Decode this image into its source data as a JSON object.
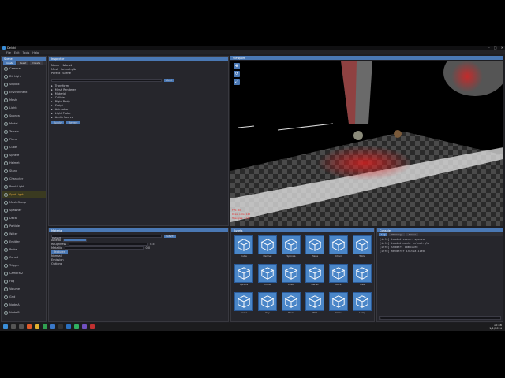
{
  "window": {
    "title": "Deluki",
    "controls": [
      "–",
      "□",
      "✕"
    ]
  },
  "menu": [
    "File",
    "Edit",
    "Tools",
    "Help"
  ],
  "hierarchy": {
    "header": "Scene",
    "tabs": [
      "Create",
      "Reset",
      "Delete"
    ],
    "items": [
      "Camera",
      "Dir Light",
      "Skybox",
      "Environment",
      "Mesh",
      "Light",
      "Sponza",
      "Model",
      "Terrain",
      "Plane",
      "Cube",
      "Sphere",
      "Helmet",
      "Stand",
      "Character",
      "Point Light",
      "Spot Light",
      "Mesh Group",
      "Spawner",
      "Decal",
      "Particle",
      "Water",
      "Emitter",
      "Probe",
      "Sound",
      "Trigger",
      "Camera 2",
      "Fog",
      "Volume",
      "Grid",
      "Node A",
      "Node B"
    ],
    "selected_index": 16
  },
  "inspector": {
    "header": "Inspector",
    "fields": [
      {
        "label": "Name",
        "value": "Helmet"
      },
      {
        "label": "Mesh",
        "value": "helmet.glb"
      },
      {
        "label": "Parent",
        "value": "Scene"
      }
    ],
    "button": "Add",
    "components": [
      "Transform",
      "Mesh Renderer",
      "Material",
      "Collider",
      "Rigid Body",
      "Script",
      "Animation",
      "Light Probe",
      "Audio Source"
    ],
    "actions": [
      "Apply",
      "Revert"
    ]
  },
  "viewport": {
    "header": "Viewport",
    "tools": [
      "✥",
      "⟳",
      "⤢"
    ],
    "stats": [
      "FPS: 60",
      "Draw calls: 142",
      "Triangles: 324k"
    ]
  },
  "material": {
    "header": "Material",
    "fields": [
      {
        "label": "Name",
        "value": "Default"
      },
      {
        "label": "Albedo",
        "value": ""
      },
      {
        "label": "Roughness",
        "value": "0.5"
      },
      {
        "label": "Metallic",
        "value": "0.0"
      }
    ],
    "button": "Save",
    "sections": [
      "Textures",
      "Normal",
      "Emission",
      "Options"
    ]
  },
  "assets": {
    "header": "Assets",
    "items": [
      "Cube",
      "Helmet",
      "Sponza",
      "Plane",
      "Chair",
      "Table",
      "Sphere",
      "Cone",
      "Crate",
      "Barrel",
      "Rock",
      "Tree",
      "Grass",
      "Sky",
      "Floor",
      "Wall",
      "Door",
      "Lamp"
    ]
  },
  "console": {
    "header": "Console",
    "tabs": [
      "Log",
      "Warnings",
      "Errors"
    ],
    "lines": [
      "[info] Loaded scene: sponza",
      "[info] Loaded mesh: helmet.glb",
      "[info] Shaders compiled",
      "[info] Renderer initialized"
    ],
    "input_placeholder": ">"
  },
  "taskbar": {
    "time": "12:46",
    "date": "1/1/2024"
  }
}
